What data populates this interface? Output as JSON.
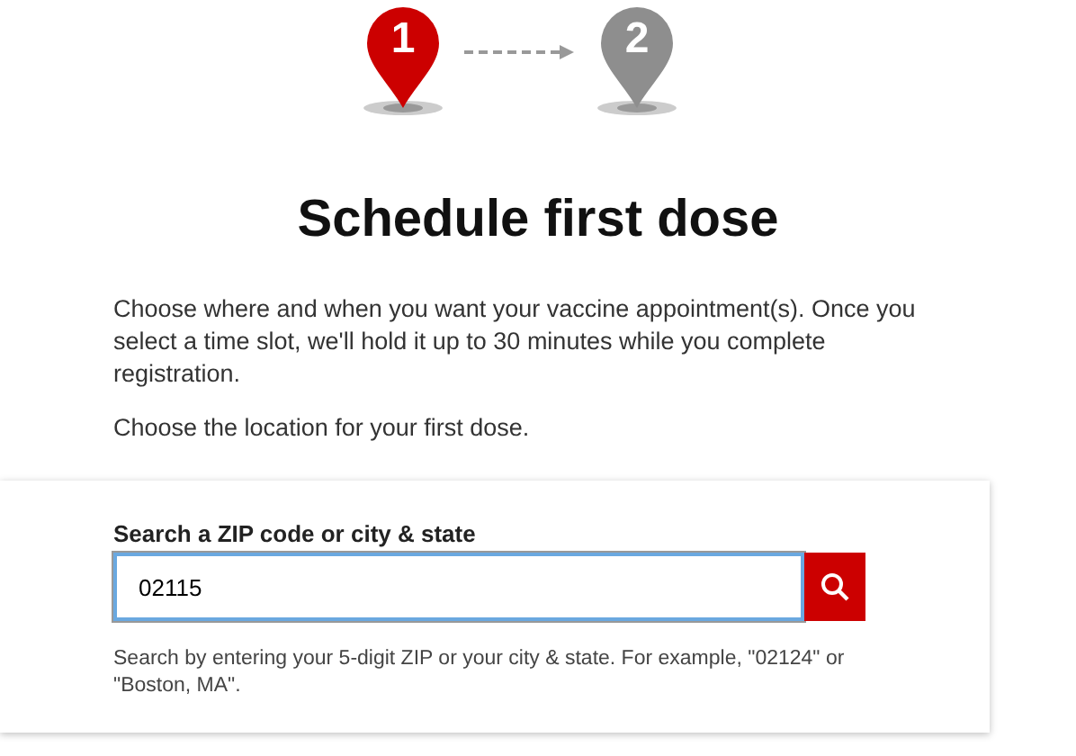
{
  "steps": [
    {
      "number": "1",
      "selected": true
    },
    {
      "number": "2",
      "selected": false
    }
  ],
  "title": "Schedule first dose",
  "intro": [
    "Choose where and when you want your vaccine appointment(s). Once you select a time slot, we'll hold it up to 30 minutes while you complete registration.",
    "Choose the location for your first dose."
  ],
  "search": {
    "label": "Search a ZIP code or city & state",
    "value": "02115",
    "hint": "Search by entering your 5-digit ZIP or your city & state. For example, \"02124\" or \"Boston, MA\"."
  }
}
